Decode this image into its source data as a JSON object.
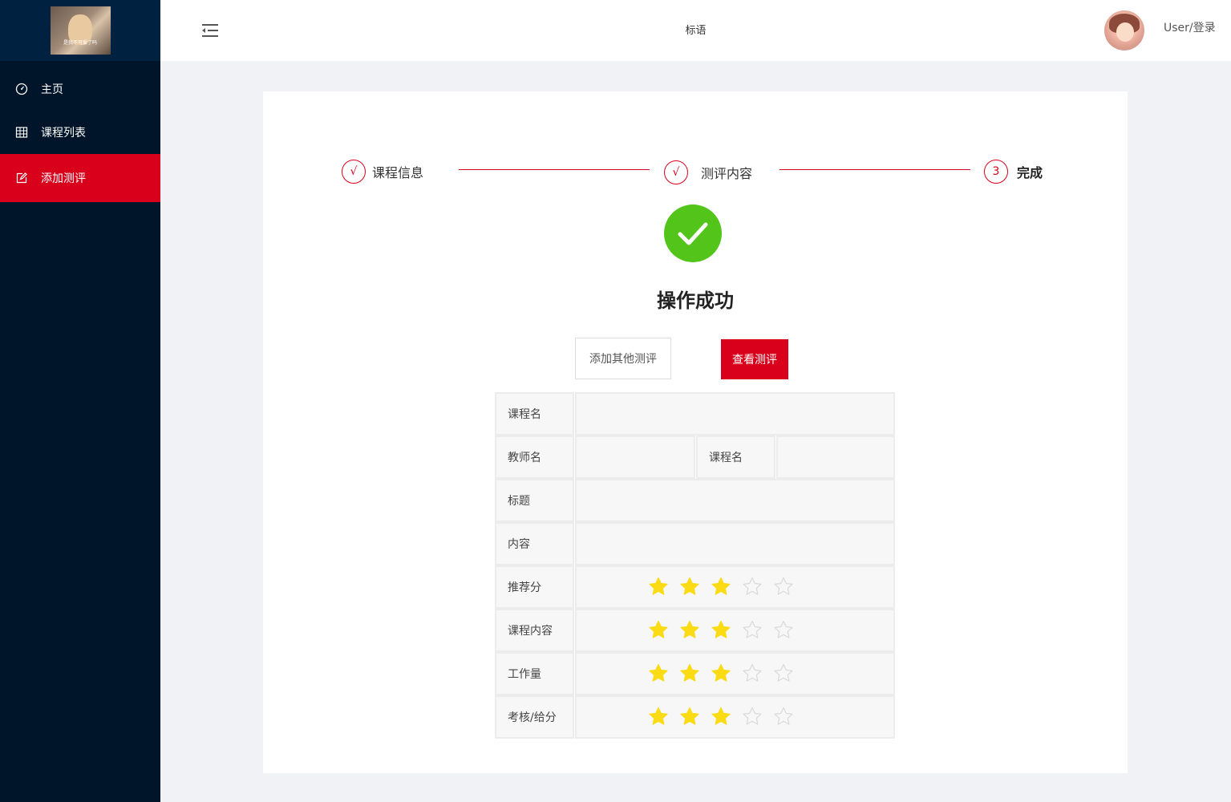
{
  "sidebar": {
    "logo_caption": "是我不可爱了吗",
    "items": [
      {
        "label": "主页",
        "icon": "dashboard-icon"
      },
      {
        "label": "课程列表",
        "icon": "table-icon"
      },
      {
        "label": "添加测评",
        "icon": "edit-icon",
        "active": true
      }
    ]
  },
  "header": {
    "title": "标语",
    "user_login": "User/登录"
  },
  "steps": [
    {
      "mark": "√",
      "label": "课程信息"
    },
    {
      "mark": "√",
      "label": "测评内容"
    },
    {
      "mark": "3",
      "label": "完成"
    }
  ],
  "result": {
    "title": "操作成功",
    "add_other_label": "添加其他测评",
    "view_label": "查看测评"
  },
  "table": {
    "course_name_label": "课程名",
    "teacher_name_label": "教师名",
    "course_name_label_2": "课程名",
    "title_label": "标题",
    "content_label": "内容",
    "ratings": [
      {
        "label": "推荐分",
        "value": 3,
        "max": 5
      },
      {
        "label": "课程内容",
        "value": 3,
        "max": 5
      },
      {
        "label": "工作量",
        "value": 3,
        "max": 5
      },
      {
        "label": "考核/给分",
        "value": 3,
        "max": 5
      }
    ]
  },
  "colors": {
    "brand": "#d9001b",
    "sidebar": "#001529",
    "success": "#52c41a",
    "star_filled": "#fadb14",
    "star_empty": "#e8e8e8"
  }
}
